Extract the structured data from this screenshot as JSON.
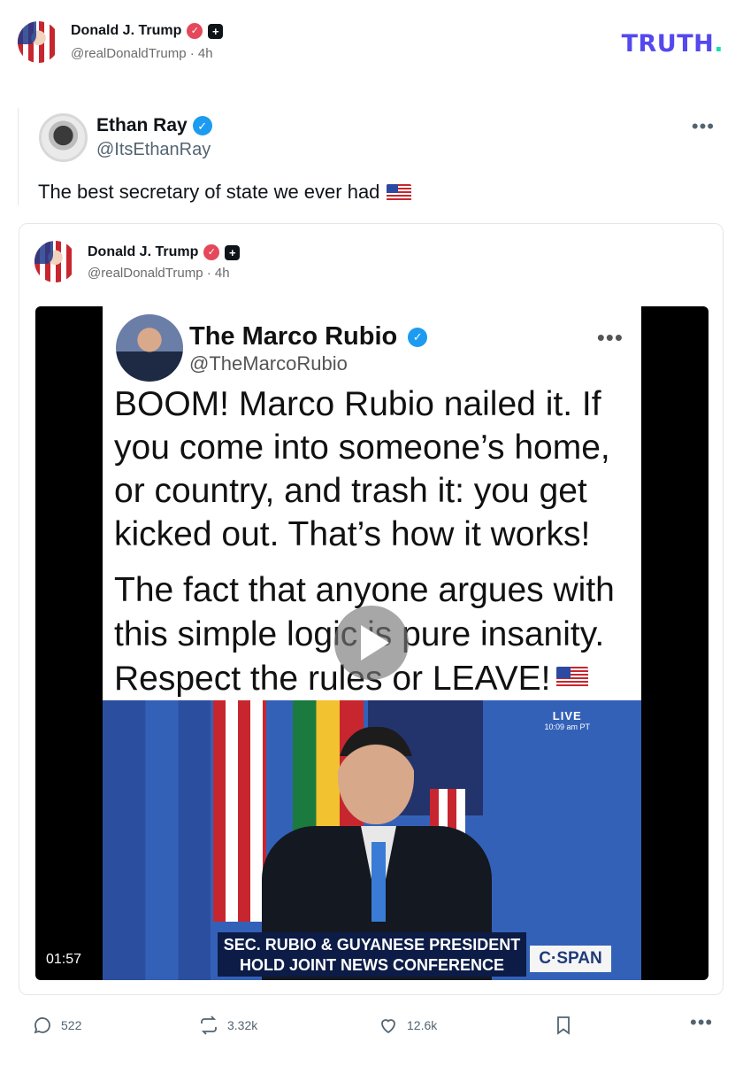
{
  "brand": {
    "logo_text": "TRUTH",
    "logo_dot": ".",
    "colors": {
      "logo": "#5448ee",
      "logo_dot": "#17e0a8",
      "verified_red": "#e5485b",
      "verified_blue": "#1d9bf0"
    }
  },
  "post": {
    "author_name": "Donald J. Trump",
    "handle": "@realDonaldTrump",
    "time": "4h",
    "separator": "·"
  },
  "quoted_tweet": {
    "author_name": "Ethan Ray",
    "handle": "@ItsEthanRay",
    "text": "The best secretary of state we ever had",
    "more_icon": "more-dots-icon"
  },
  "embedded_post": {
    "author_name": "Donald J. Trump",
    "handle": "@realDonaldTrump",
    "time": "4h",
    "separator": "·",
    "video": {
      "duration": "01:57",
      "tweet_screenshot": {
        "name": "The Marco Rubio",
        "handle": "@TheMarcoRubio",
        "paragraph1": "BOOM! Marco Rubio nailed it. If you come into someone’s home, or country, and trash it: you get kicked out. That’s how it works!",
        "paragraph2": "The fact that anyone argues with this simple logic is pure insanity. Respect the rules or LEAVE!"
      },
      "news": {
        "live_label": "LIVE",
        "live_time": "10:09 am PT",
        "chyron_line1": "SEC. RUBIO & GUYANESE PRESIDENT",
        "chyron_line2": "HOLD JOINT NEWS CONFERENCE",
        "network": "C·SPAN"
      }
    }
  },
  "actions": {
    "replies": "522",
    "retruths": "3.32k",
    "likes": "12.6k"
  }
}
